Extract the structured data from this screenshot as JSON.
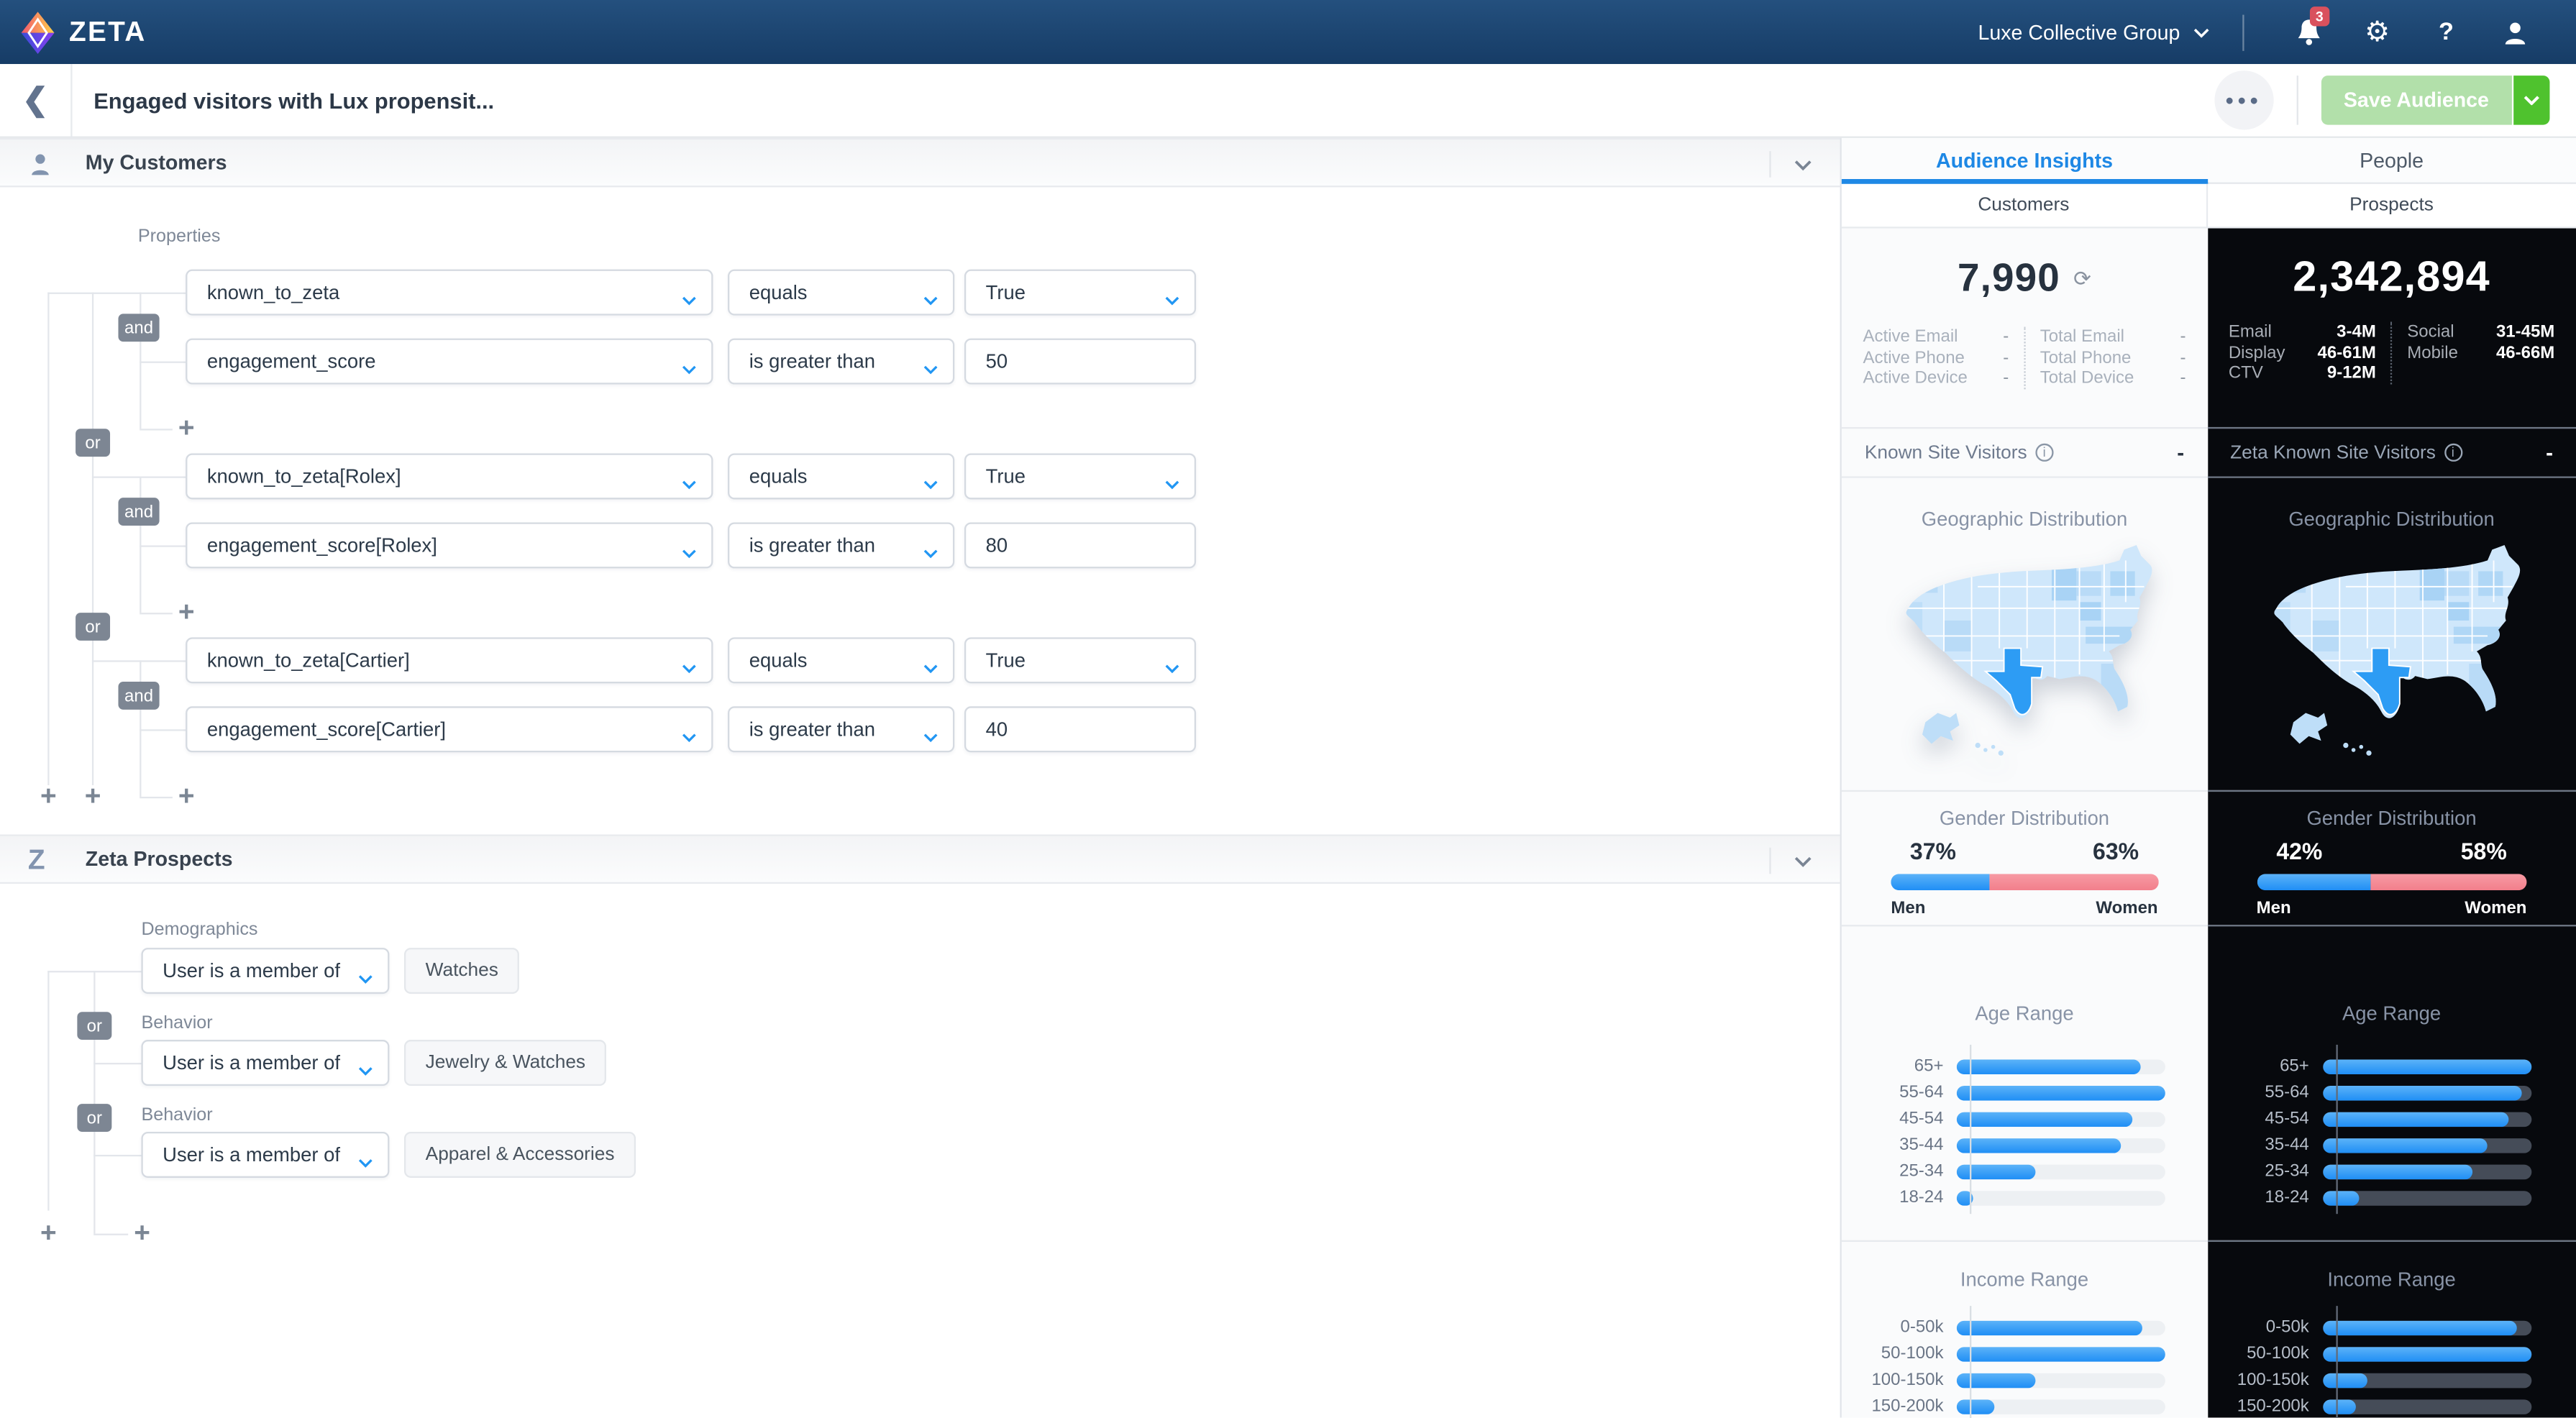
{
  "navbar": {
    "brand": "ZETA",
    "account_selector": "Luxe Collective Group",
    "notification_count": "3"
  },
  "title_bar": {
    "title": "Engaged visitors with Lux propensit...",
    "save_button_label": "Save Audience"
  },
  "builder": {
    "my_customers": {
      "title": "My Customers",
      "properties_label": "Properties",
      "and_label": "and",
      "or_label": "or",
      "rows": [
        {
          "field": "known_to_zeta",
          "operator": "equals",
          "value": "True"
        },
        {
          "field": "engagement_score",
          "operator": "is greater than",
          "value": "50"
        },
        {
          "field": "known_to_zeta[Rolex]",
          "operator": "equals",
          "value": "True"
        },
        {
          "field": "engagement_score[Rolex]",
          "operator": "is greater than",
          "value": "80"
        },
        {
          "field": "known_to_zeta[Cartier]",
          "operator": "equals",
          "value": "True"
        },
        {
          "field": "engagement_score[Cartier]",
          "operator": "is greater than",
          "value": "40"
        }
      ]
    },
    "zeta_prospects": {
      "title": "Zeta Prospects",
      "or_label": "or",
      "rows": [
        {
          "label": "Demographics",
          "operator": "User is a member of",
          "segment": "Watches"
        },
        {
          "label": "Behavior",
          "operator": "User is a member of",
          "segment": "Jewelry & Watches"
        },
        {
          "label": "Behavior",
          "operator": "User is a member of",
          "segment": "Apparel & Accessories"
        }
      ]
    }
  },
  "insights": {
    "tab_audience": "Audience Insights",
    "tab_people": "People",
    "col_customers": "Customers",
    "col_prospects": "Prospects",
    "customers": {
      "total": "7,990",
      "stats_left": [
        {
          "label": "Active Email",
          "value": "-"
        },
        {
          "label": "Active Phone",
          "value": "-"
        },
        {
          "label": "Active Device",
          "value": "-"
        }
      ],
      "stats_right": [
        {
          "label": "Total Email",
          "value": "-"
        },
        {
          "label": "Total Phone",
          "value": "-"
        },
        {
          "label": "Total Device",
          "value": "-"
        }
      ],
      "known_visitors": {
        "label": "Known Site Visitors",
        "value": "-"
      },
      "geo_title": "Geographic Distribution",
      "gender": {
        "title": "Gender Distribution",
        "men_pct": "37%",
        "women_pct": "63%",
        "men_label": "Men",
        "women_label": "Women",
        "men_width": 37
      },
      "age": {
        "title": "Age Range",
        "rows": [
          {
            "label": "65+",
            "pct": 88
          },
          {
            "label": "55-64",
            "pct": 100
          },
          {
            "label": "45-54",
            "pct": 84
          },
          {
            "label": "35-44",
            "pct": 79
          },
          {
            "label": "25-34",
            "pct": 38
          },
          {
            "label": "18-24",
            "pct": 8
          }
        ]
      },
      "income": {
        "title": "Income Range",
        "rows": [
          {
            "label": "0-50k",
            "pct": 89
          },
          {
            "label": "50-100k",
            "pct": 100
          },
          {
            "label": "100-150k",
            "pct": 38
          },
          {
            "label": "150-200k",
            "pct": 18
          }
        ]
      }
    },
    "prospects": {
      "total": "2,342,894",
      "stats_left": [
        {
          "label": "Email",
          "value": "3-4M"
        },
        {
          "label": "Display",
          "value": "46-61M"
        },
        {
          "label": "CTV",
          "value": "9-12M"
        }
      ],
      "stats_right": [
        {
          "label": "Social",
          "value": "31-45M"
        },
        {
          "label": "Mobile",
          "value": "46-66M"
        }
      ],
      "known_visitors": {
        "label": "Zeta Known Site Visitors",
        "value": "-"
      },
      "geo_title": "Geographic Distribution",
      "gender": {
        "title": "Gender Distribution",
        "men_pct": "42%",
        "women_pct": "58%",
        "men_label": "Men",
        "women_label": "Women",
        "men_width": 42
      },
      "age": {
        "title": "Age Range",
        "rows": [
          {
            "label": "65+",
            "pct": 100
          },
          {
            "label": "55-64",
            "pct": 96
          },
          {
            "label": "45-54",
            "pct": 89
          },
          {
            "label": "35-44",
            "pct": 79
          },
          {
            "label": "25-34",
            "pct": 72
          },
          {
            "label": "18-24",
            "pct": 18
          }
        ]
      },
      "income": {
        "title": "Income Range",
        "rows": [
          {
            "label": "0-50k",
            "pct": 93
          },
          {
            "label": "50-100k",
            "pct": 100
          },
          {
            "label": "100-150k",
            "pct": 22
          },
          {
            "label": "150-200k",
            "pct": 16
          }
        ]
      }
    }
  },
  "colors": {
    "accent_blue": "#1E88E5",
    "bar_blue": "#2D9CF4",
    "gender_women_pink": "#F4858F",
    "save_green": "#4FC22E",
    "save_green_disabled": "#B2E0AA",
    "navbar_top": "#24507E",
    "navbar_bottom": "#163C66",
    "notification_red": "#D9515D",
    "dark_panel": "#07090D",
    "map_state_base": "#CFE7FB",
    "map_state_highlight": "#2D9CF4"
  }
}
